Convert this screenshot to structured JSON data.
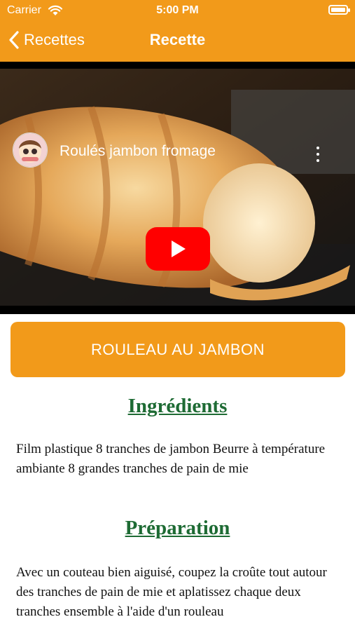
{
  "status_bar": {
    "carrier": "Carrier",
    "time": "5:00 PM"
  },
  "nav": {
    "back_label": "Recettes",
    "title": "Recette"
  },
  "video": {
    "title": "Roulés jambon fromage"
  },
  "recipe_button": {
    "label": "ROULEAU AU JAMBON"
  },
  "ingredients": {
    "heading": "Ingrédients",
    "text": "Film plastique 8 tranches de jambon Beurre à température ambiante 8 grandes tranches de pain de mie"
  },
  "preparation": {
    "heading": "Préparation",
    "text": "Avec un couteau bien aiguisé, coupez la croûte tout autour des tranches de pain de mie et aplatissez chaque deux tranches ensemble à l'aide d'un rouleau"
  },
  "colors": {
    "accent": "#F29A1A",
    "heading_green": "#1E6B34",
    "play_red": "#FF0000"
  }
}
